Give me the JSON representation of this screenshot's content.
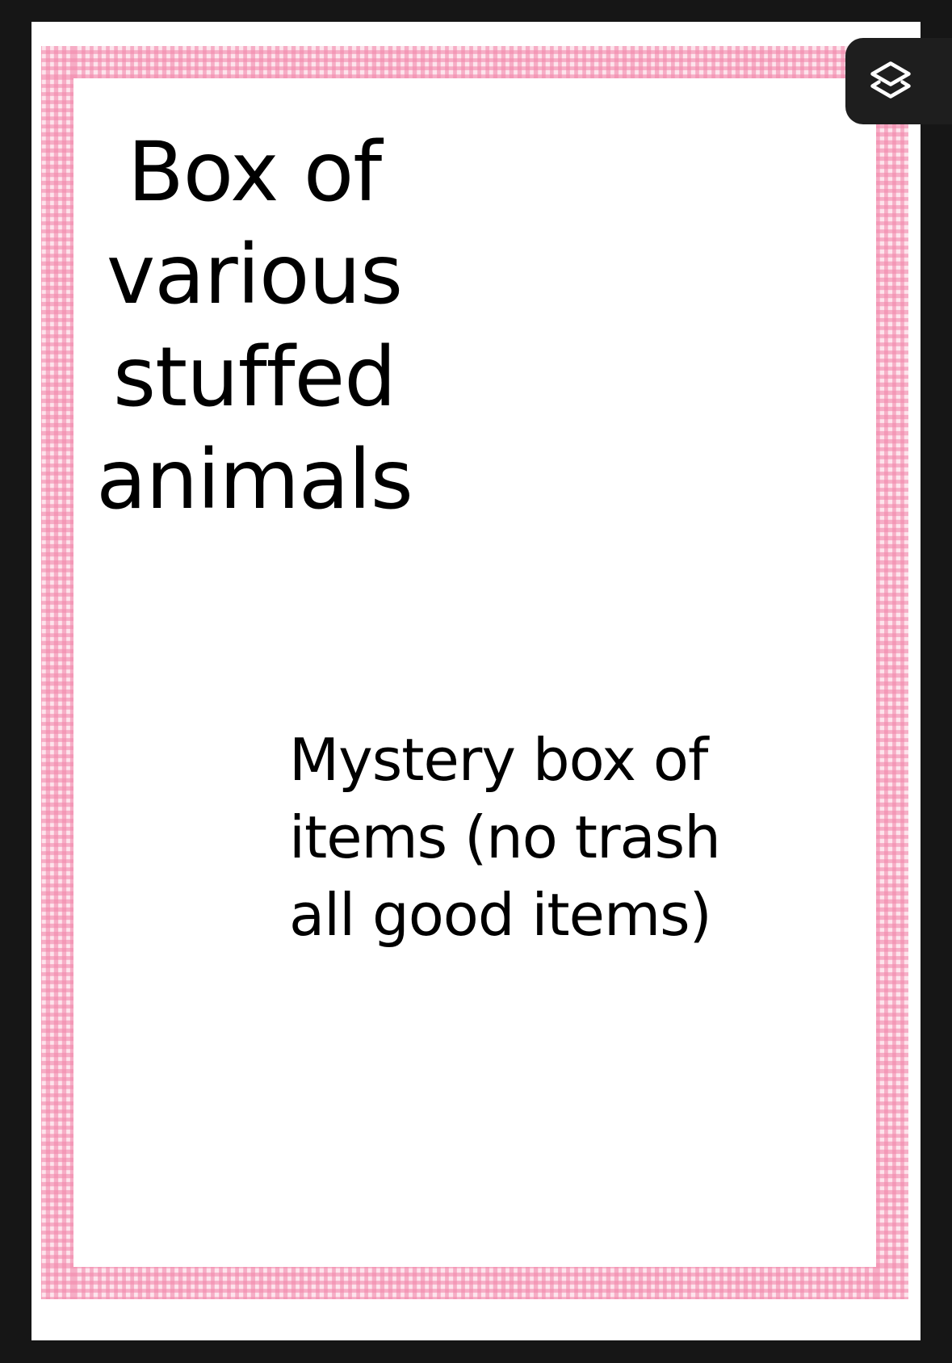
{
  "document": {
    "title": "Box of\nvarious\nstuffed\nanimals",
    "subtitle": "Mystery box of\nitems (no trash\nall good items)"
  },
  "toolbar": {
    "layers_icon": "layers-icon"
  },
  "colors": {
    "background": "#161616",
    "page": "#ffffff",
    "gingham_pink": "#f289ac",
    "text": "#000000",
    "button_bg": "#1e1e1e"
  }
}
